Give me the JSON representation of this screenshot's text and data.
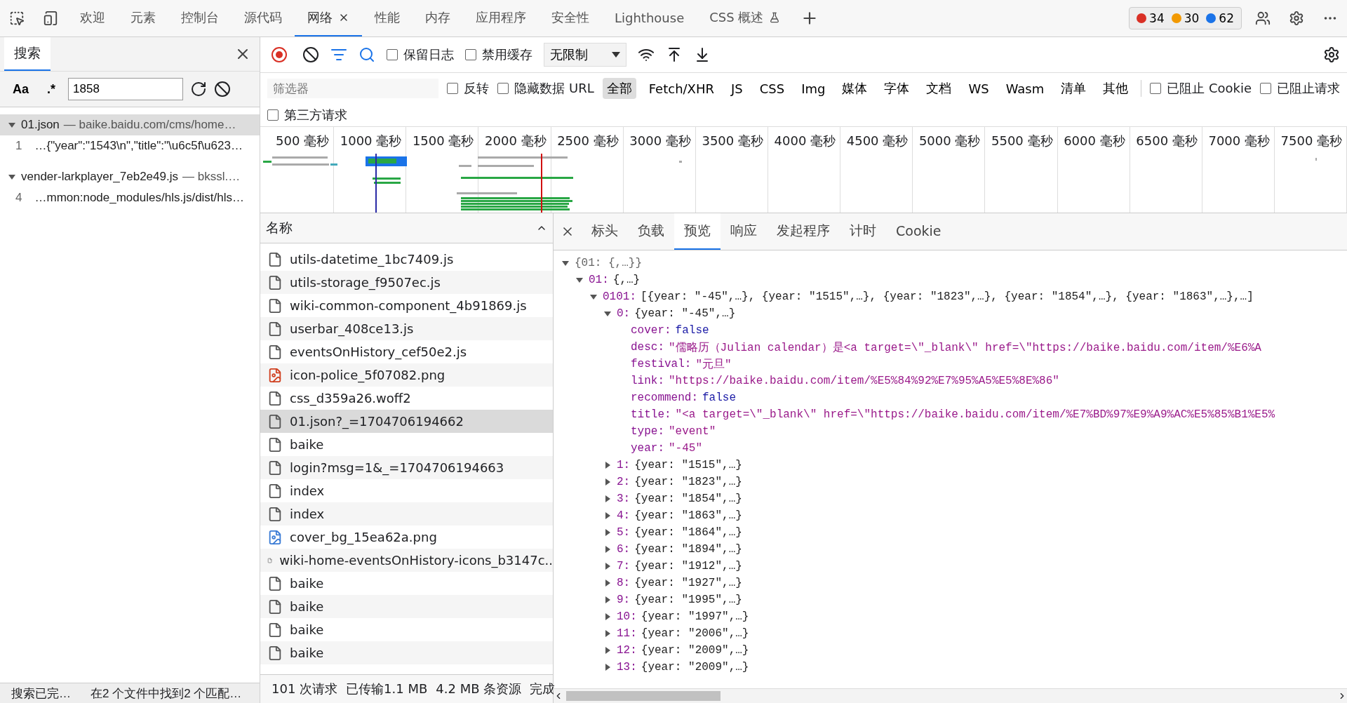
{
  "top_tabs": [
    {
      "label": "欢迎",
      "selected": false,
      "closable": false,
      "experimental": false
    },
    {
      "label": "元素",
      "selected": false,
      "closable": false,
      "experimental": false
    },
    {
      "label": "控制台",
      "selected": false,
      "closable": false,
      "experimental": false
    },
    {
      "label": "源代码",
      "selected": false,
      "closable": false,
      "experimental": false
    },
    {
      "label": "网络",
      "selected": true,
      "closable": true,
      "experimental": false
    },
    {
      "label": "性能",
      "selected": false,
      "closable": false,
      "experimental": false
    },
    {
      "label": "内存",
      "selected": false,
      "closable": false,
      "experimental": false
    },
    {
      "label": "应用程序",
      "selected": false,
      "closable": false,
      "experimental": false
    },
    {
      "label": "安全性",
      "selected": false,
      "closable": false,
      "experimental": false
    },
    {
      "label": "Lighthouse",
      "selected": false,
      "closable": false,
      "experimental": false
    },
    {
      "label": "CSS 概述",
      "selected": false,
      "closable": false,
      "experimental": true
    }
  ],
  "issue_counts": [
    {
      "kind": "error",
      "count": "34"
    },
    {
      "kind": "warning",
      "count": "30"
    },
    {
      "kind": "info",
      "count": "62"
    }
  ],
  "search_panel": {
    "tab": "搜索",
    "case_toggle": "Aa",
    "regex_toggle": ".*",
    "query": "1858",
    "results": [
      {
        "file": "01.json",
        "source": "— baike.baidu.com/cms/home…",
        "selected": true,
        "expanded": true,
        "matches": [
          {
            "line": "1",
            "text": "…{\"year\":\"1543\\n\",\"title\":\"\\u6c5f\\u623…"
          }
        ]
      },
      {
        "file": "vender-larkplayer_7eb2e49.js",
        "source": "— bkssl.…",
        "selected": false,
        "expanded": true,
        "matches": [
          {
            "line": "4",
            "text": "…mmon:node_modules/hls.js/dist/hls…"
          }
        ]
      }
    ],
    "status": [
      "搜索已完…",
      "在2 个文件中找到2 个匹配…"
    ]
  },
  "toolbar": {
    "recording": true,
    "checkboxes": [
      {
        "label": "保留日志",
        "checked": false
      },
      {
        "label": "禁用缓存",
        "checked": false
      }
    ],
    "throttling": "无限制"
  },
  "filter_bar": {
    "placeholder": "筛选器",
    "checkboxes": [
      {
        "label": "反转",
        "checked": false
      },
      {
        "label": "隐藏数据 URL",
        "checked": false
      }
    ],
    "types": [
      {
        "label": "全部",
        "selected": true
      },
      {
        "label": "Fetch/XHR",
        "selected": false
      },
      {
        "label": "JS",
        "selected": false
      },
      {
        "label": "CSS",
        "selected": false
      },
      {
        "label": "Img",
        "selected": false
      },
      {
        "label": "媒体",
        "selected": false
      },
      {
        "label": "字体",
        "selected": false
      },
      {
        "label": "文档",
        "selected": false
      },
      {
        "label": "WS",
        "selected": false
      },
      {
        "label": "Wasm",
        "selected": false
      },
      {
        "label": "清单",
        "selected": false
      },
      {
        "label": "其他",
        "selected": false
      }
    ],
    "more_checkboxes": [
      {
        "label": "已阻止 Cookie",
        "checked": false
      },
      {
        "label": "已阻止请求",
        "checked": false
      }
    ],
    "third_party": {
      "label": "第三方请求",
      "checked": false
    }
  },
  "timeline_ticks": [
    "500 毫秒",
    "1000 毫秒",
    "1500 毫秒",
    "2000 毫秒",
    "2500 毫秒",
    "3000 毫秒",
    "3500 毫秒",
    "4000 毫秒",
    "4500 毫秒",
    "5000 毫秒",
    "5500 毫秒",
    "6000 毫秒",
    "6500 毫秒",
    "7000 毫秒",
    "7500 毫秒"
  ],
  "requests": {
    "column": "名称",
    "rows": [
      {
        "name": "utils-datetime_1bc7409.js",
        "kind": "file",
        "selected": false
      },
      {
        "name": "utils-storage_f9507ec.js",
        "kind": "file",
        "selected": false
      },
      {
        "name": "wiki-common-component_4b91869.js",
        "kind": "file",
        "selected": false
      },
      {
        "name": "userbar_408ce13.js",
        "kind": "file",
        "selected": false
      },
      {
        "name": "eventsOnHistory_cef50e2.js",
        "kind": "file",
        "selected": false
      },
      {
        "name": "icon-police_5f07082.png",
        "kind": "image",
        "selected": false
      },
      {
        "name": "css_d359a26.woff2",
        "kind": "file",
        "selected": false
      },
      {
        "name": "01.json?_=1704706194662",
        "kind": "file",
        "selected": true
      },
      {
        "name": "baike",
        "kind": "file",
        "selected": false
      },
      {
        "name": "login?msg=1&_=1704706194663",
        "kind": "file",
        "selected": false
      },
      {
        "name": "index",
        "kind": "file",
        "selected": false
      },
      {
        "name": "index",
        "kind": "file",
        "selected": false
      },
      {
        "name": "cover_bg_15ea62a.png",
        "kind": "picture",
        "selected": false
      },
      {
        "name": "wiki-home-eventsOnHistory-icons_b3147c..",
        "kind": "file",
        "selected": false
      },
      {
        "name": "baike",
        "kind": "file",
        "selected": false
      },
      {
        "name": "baike",
        "kind": "file",
        "selected": false
      },
      {
        "name": "baike",
        "kind": "file",
        "selected": false
      },
      {
        "name": "baike",
        "kind": "file",
        "selected": false
      }
    ],
    "summary": [
      "101 次请求",
      "已传输1.1 MB",
      "4.2 MB 条资源",
      "完成"
    ]
  },
  "detail_tabs": [
    {
      "label": "标头",
      "selected": false
    },
    {
      "label": "负载",
      "selected": false
    },
    {
      "label": "预览",
      "selected": true
    },
    {
      "label": "响应",
      "selected": false
    },
    {
      "label": "发起程序",
      "selected": false
    },
    {
      "label": "计时",
      "selected": false
    },
    {
      "label": "Cookie",
      "selected": false
    }
  ],
  "preview": {
    "summary": "{01: {,…}}",
    "expanded": true,
    "children": [
      {
        "key": "01:",
        "summary": "{,…}",
        "expanded": true,
        "children": [
          {
            "key": "0101:",
            "summary": "[{year: \"-45\",…}, {year: \"1515\",…}, {year: \"1823\",…}, {year: \"1854\",…}, {year: \"1863\",…},…]",
            "expanded": true,
            "children": [
              {
                "key": "0:",
                "summary": "{year: \"-45\",…}",
                "expanded": true,
                "children": [
                  {
                    "key": "cover:",
                    "value": "false",
                    "kind": "boolean"
                  },
                  {
                    "key": "desc:",
                    "value": "\"儒略历（Julian calendar）是<a target=\\\"_blank\\\" href=\\\"https://baike.baidu.com/item/%E6%A",
                    "kind": "string"
                  },
                  {
                    "key": "festival:",
                    "value": "\"元旦\"",
                    "kind": "string"
                  },
                  {
                    "key": "link:",
                    "value": "\"https://baike.baidu.com/item/%E5%84%92%E7%95%A5%E5%8E%86\"",
                    "kind": "string"
                  },
                  {
                    "key": "recommend:",
                    "value": "false",
                    "kind": "boolean"
                  },
                  {
                    "key": "title:",
                    "value": "\"<a target=\\\"_blank\\\" href=\\\"https://baike.baidu.com/item/%E7%BD%97%E9%A9%AC%E5%85%B1%E5%",
                    "kind": "string"
                  },
                  {
                    "key": "type:",
                    "value": "\"event\"",
                    "kind": "string"
                  },
                  {
                    "key": "year:",
                    "value": "\"-45\"",
                    "kind": "string"
                  }
                ]
              },
              {
                "key": "1:",
                "summary": "{year: \"1515\",…}",
                "expanded": false
              },
              {
                "key": "2:",
                "summary": "{year: \"1823\",…}",
                "expanded": false
              },
              {
                "key": "3:",
                "summary": "{year: \"1854\",…}",
                "expanded": false
              },
              {
                "key": "4:",
                "summary": "{year: \"1863\",…}",
                "expanded": false
              },
              {
                "key": "5:",
                "summary": "{year: \"1864\",…}",
                "expanded": false
              },
              {
                "key": "6:",
                "summary": "{year: \"1894\",…}",
                "expanded": false
              },
              {
                "key": "7:",
                "summary": "{year: \"1912\",…}",
                "expanded": false
              },
              {
                "key": "8:",
                "summary": "{year: \"1927\",…}",
                "expanded": false
              },
              {
                "key": "9:",
                "summary": "{year: \"1995\",…}",
                "expanded": false
              },
              {
                "key": "10:",
                "summary": "{year: \"1997\",…}",
                "expanded": false
              },
              {
                "key": "11:",
                "summary": "{year: \"2006\",…}",
                "expanded": false
              },
              {
                "key": "12:",
                "summary": "{year: \"2009\",…}",
                "expanded": false
              },
              {
                "key": "13:",
                "summary": "{year: \"2009\",…}",
                "expanded": false
              }
            ]
          }
        ]
      }
    ]
  }
}
